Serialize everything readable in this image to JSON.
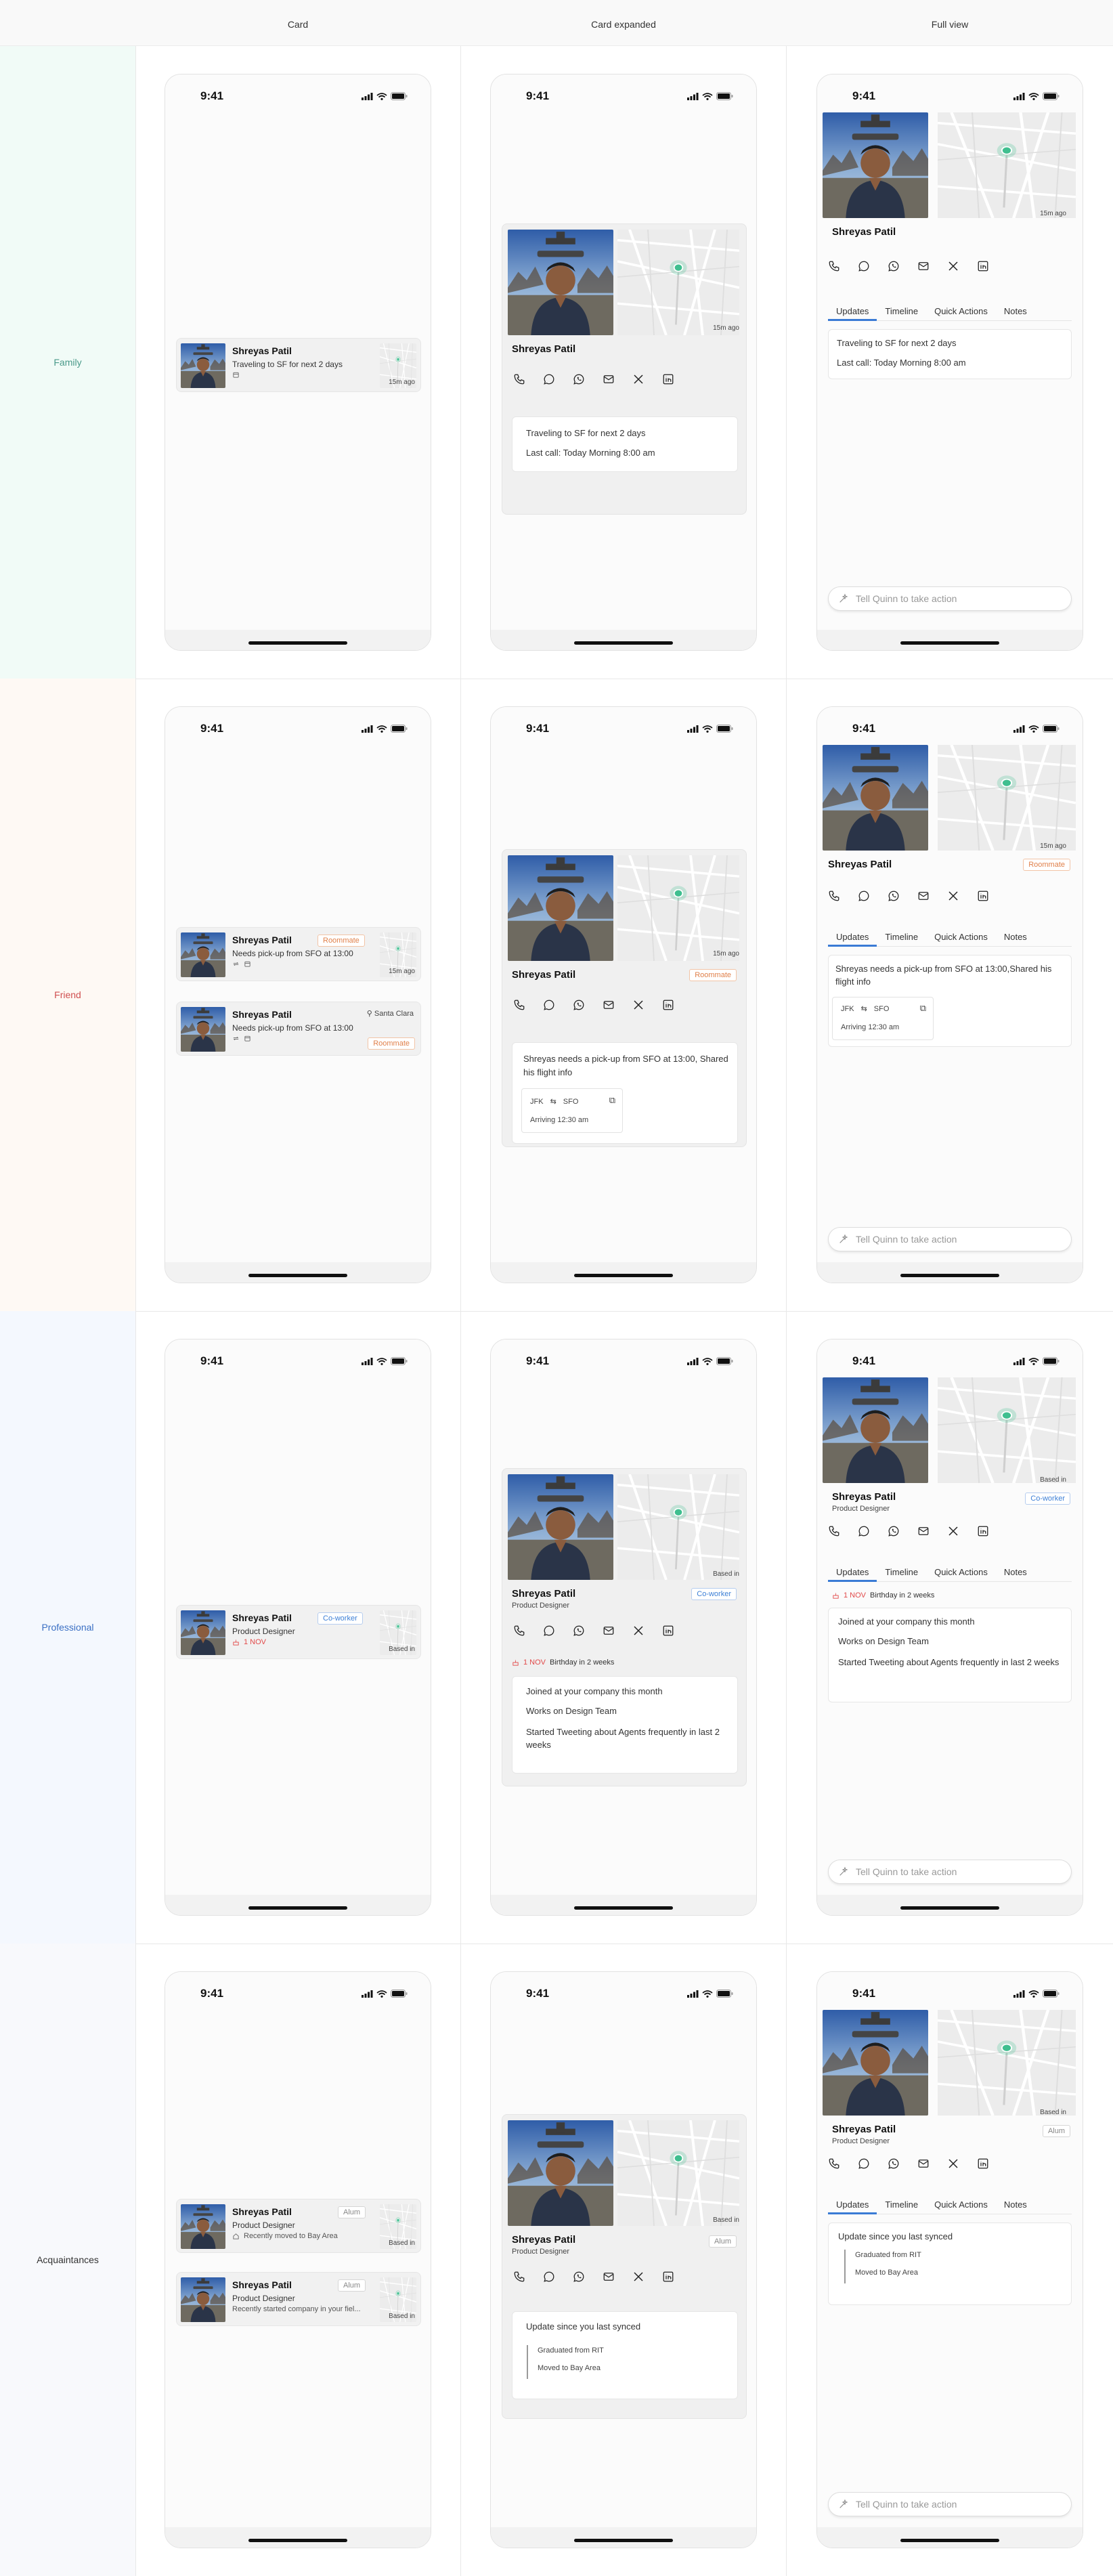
{
  "columns": [
    "Card",
    "Card expanded",
    "Full view"
  ],
  "rows": [
    "Family",
    "Friend",
    "Professional",
    "Acquaintances"
  ],
  "row_colors": [
    "#f1fbf7",
    "#fef9f4",
    "#f4f8fe",
    "#f8f9fc"
  ],
  "row_label_colors": [
    "#4a9a8a",
    "#d05050",
    "#3a6fc4",
    "#333333"
  ],
  "status": {
    "time": "9:41"
  },
  "person": {
    "name": "Shreyas Patil",
    "title": "Product Designer"
  },
  "family": {
    "card_status": "Traveling to SF for next 2 days",
    "ago": "15m ago",
    "updates": [
      "Traveling to SF for next 2 days",
      "Last call: Today Morning 8:00 am"
    ]
  },
  "friend": {
    "tag": "Roommate",
    "card_status": "Needs pick-up from SFO at 13:00",
    "location": "Santa Clara",
    "ago": "15m ago",
    "update": "Shreyas needs a pick-up from SFO at 13:00, Shared his flight info",
    "update_full": "Shreyas needs a pick-up from SFO at 13:00,Shared his flight info",
    "flight_from": "JFK",
    "flight_to": "SFO",
    "arriving": "Arriving 12:30 am"
  },
  "professional": {
    "tag": "Co-worker",
    "birthday_date": "1 NOV",
    "birthday_text": "Birthday in 2 weeks",
    "based": "Based in",
    "updates": [
      "Joined at your company this month",
      "Works on Design Team",
      "Started Tweeting about Agents frequently in last 2 weeks"
    ]
  },
  "acquaintance": {
    "tag": "Alum",
    "based": "Based in",
    "card1_status": "Recently moved to Bay Area",
    "card2_status": "Recently started company in your fiel...",
    "update_header": "Update since you last synced",
    "timeline": [
      "Graduated from RIT",
      "Moved to Bay Area"
    ]
  },
  "tabs": [
    "Updates",
    "Timeline",
    "Quick Actions",
    "Notes"
  ],
  "ask_placeholder": "Tell Quinn to take action",
  "contact_icons": [
    "phone-icon",
    "message-icon",
    "whatsapp-icon",
    "mail-icon",
    "x-icon",
    "linkedin-icon"
  ],
  "accent": "#3a7bd5",
  "map_dot": "#3fbf8f"
}
